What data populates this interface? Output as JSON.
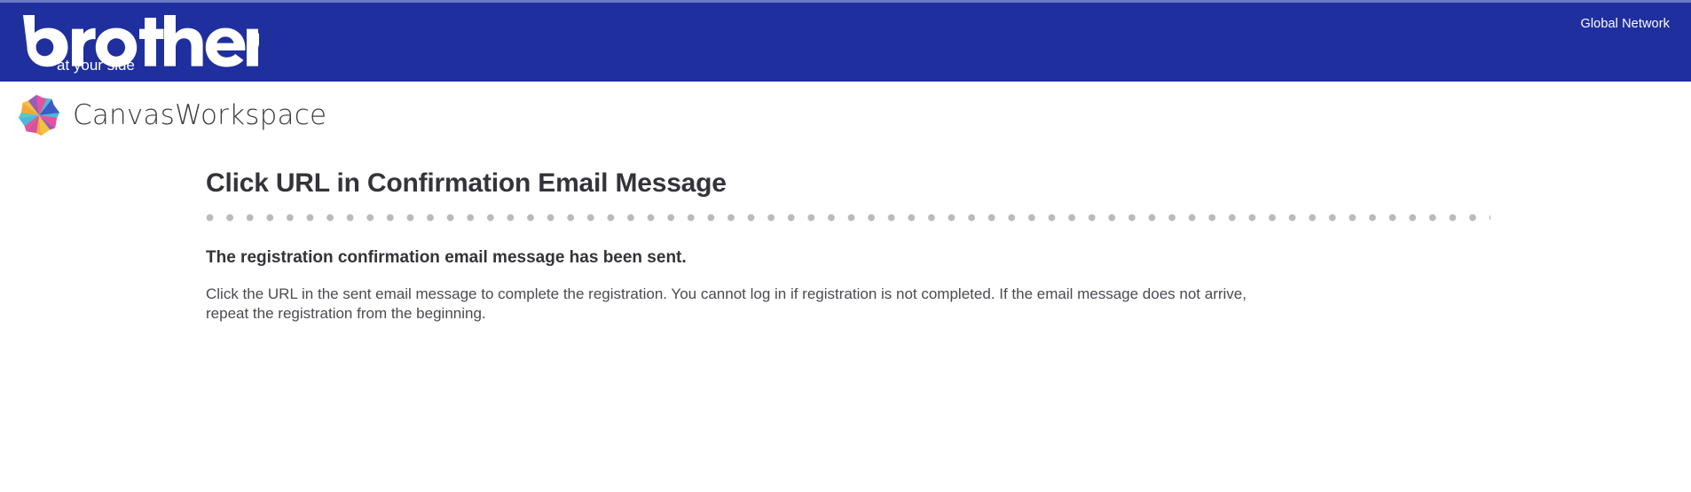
{
  "brand_bar": {
    "logo_name": "brother",
    "logo_tagline": "at your side",
    "global_network_label": "Global Network",
    "background_color": "#1f2f9e",
    "top_stripe_color": "#6b7ac4",
    "text_color": "#ffffff"
  },
  "product": {
    "mark_name": "canvasworkspace-pinwheel-logo",
    "wordmark": "CanvasWorkspace",
    "wordmark_color": "#3c3c42",
    "mark_colors": [
      "#e8519b",
      "#3d5bc4",
      "#4db8d8",
      "#f2a93b",
      "#9b5bb8",
      "#f5c13d",
      "#5ec8c0",
      "#d8519b"
    ]
  },
  "main": {
    "title": "Click URL in Confirmation Email Message",
    "divider_dot_color": "#b9babd",
    "lead": "The registration confirmation email message has been sent.",
    "body": "Click the URL in the sent email message to complete the registration. You cannot log in if registration is not completed. If the email message does not arrive, repeat the registration from the beginning."
  }
}
